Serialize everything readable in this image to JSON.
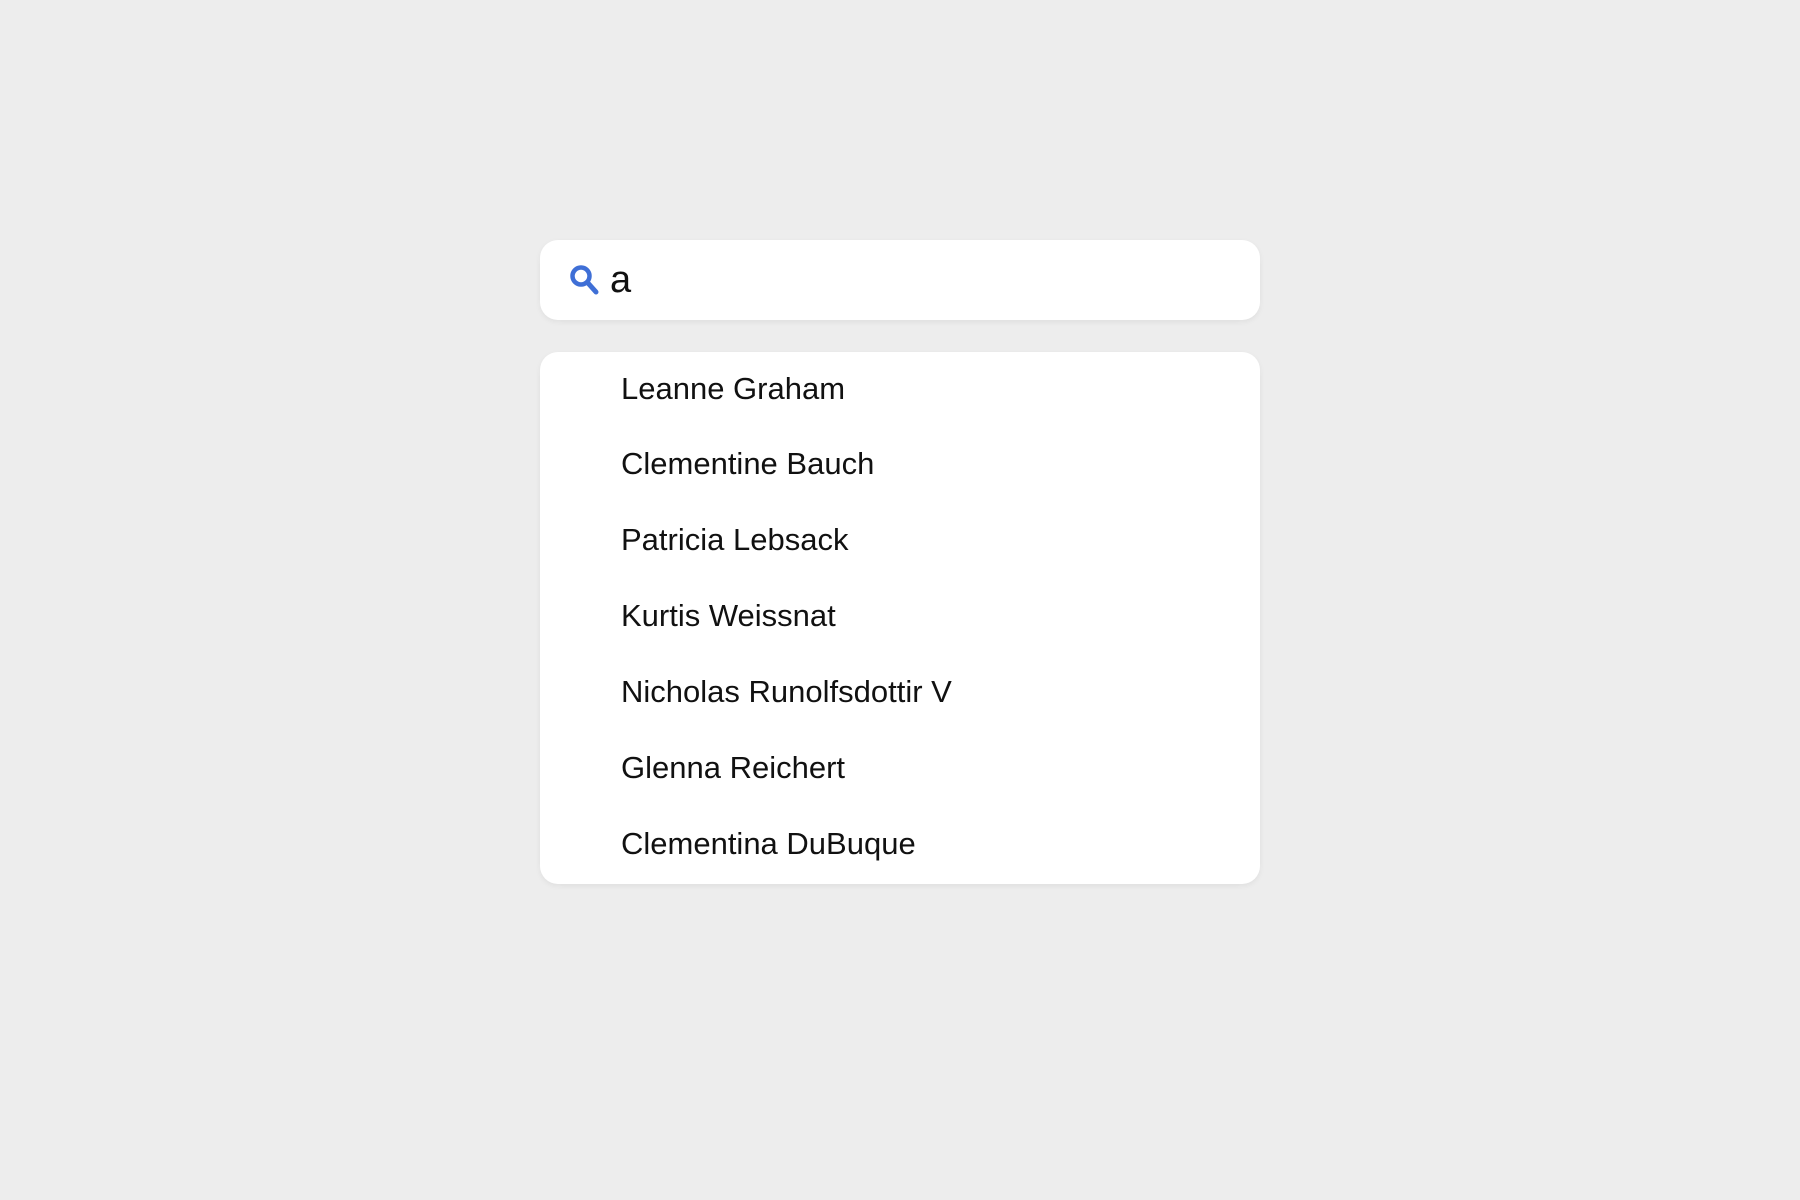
{
  "search": {
    "value": "a",
    "icon": "search-icon",
    "icon_color": "#3f6fd6"
  },
  "results": [
    {
      "label": "Leanne Graham"
    },
    {
      "label": "Clementine Bauch"
    },
    {
      "label": "Patricia Lebsack"
    },
    {
      "label": "Kurtis Weissnat"
    },
    {
      "label": "Nicholas Runolfsdottir V"
    },
    {
      "label": "Glenna Reichert"
    },
    {
      "label": "Clementina DuBuque"
    }
  ],
  "colors": {
    "background": "#ededed",
    "surface": "#ffffff",
    "text": "#111111"
  }
}
